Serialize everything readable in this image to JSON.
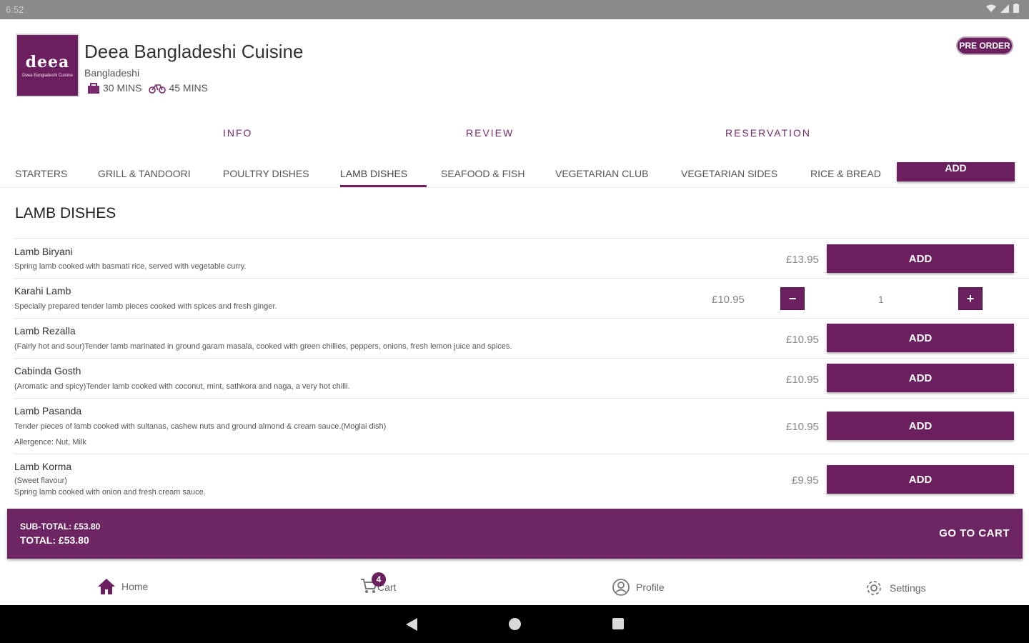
{
  "status_bar": {
    "time": "6:52"
  },
  "header": {
    "logo_text": "deea",
    "logo_subtext": "Deea Bangladeshi Cuisine",
    "restaurant_name": "Deea Bangladeshi Cuisine",
    "cuisine": "Bangladeshi",
    "collection_time": "30 MINS",
    "delivery_time": "45 MINS",
    "pre_order_label": "PRE ORDER"
  },
  "info_tabs": [
    "INFO",
    "REVIEW",
    "RESERVATION"
  ],
  "category_tabs": [
    "STARTERS",
    "GRILL & TANDOORI",
    "POULTRY DISHES",
    "LAMB DISHES",
    "SEAFOOD & FISH",
    "VEGETARIAN CLUB",
    "VEGETARIAN SIDES",
    "RICE & BREAD"
  ],
  "active_category": "LAMB DISHES",
  "overlay_add_label": "ADD",
  "section_title": "LAMB DISHES",
  "menu_items": [
    {
      "name": "Lamb Biryani",
      "desc": "Spring lamb cooked with basmati rice, served with vegetable curry.",
      "price": "£13.95",
      "action": "ADD"
    },
    {
      "name": "Karahi Lamb",
      "desc": "Specially prepared tender lamb pieces cooked with spices and fresh ginger.",
      "price": "£10.95",
      "quantity": "1",
      "minus": "−",
      "plus": "+"
    },
    {
      "name": "Lamb Rezalla",
      "desc": "(Fairly hot and sour)Tender lamb marinated in ground garam masala, cooked with green chillies, peppers, onions, fresh lemon juice and spices.",
      "price": "£10.95",
      "action": "ADD"
    },
    {
      "name": "Cabinda Gosth",
      "desc": "(Aromatic and spicy)Tender lamb cooked with coconut, mint, sathkora and naga, a very hot chilli.",
      "price": "£10.95",
      "action": "ADD"
    },
    {
      "name": "Lamb Pasanda",
      "desc": "Tender pieces of lamb cooked with sultanas, cashew nuts and ground almond & cream sauce.(Moglai dish)",
      "allergens": "Allergence: Nut, Milk",
      "price": "£10.95",
      "action": "ADD"
    },
    {
      "name": "Lamb Korma",
      "desc_top": "(Sweet flavour)",
      "desc": "Spring lamb cooked with onion and fresh cream sauce.",
      "price": "£9.95",
      "action": "ADD"
    }
  ],
  "cart_bar": {
    "subtotal": "SUB-TOTAL: £53.80",
    "total": "TOTAL: £53.80",
    "go_to_cart": "GO TO CART"
  },
  "bottom_nav": {
    "home": "Home",
    "cart": "Cart",
    "cart_count": "4",
    "profile": "Profile",
    "settings": "Settings"
  },
  "colors": {
    "brand": "#6b1f5f",
    "cart_bar": "#6e2563"
  }
}
